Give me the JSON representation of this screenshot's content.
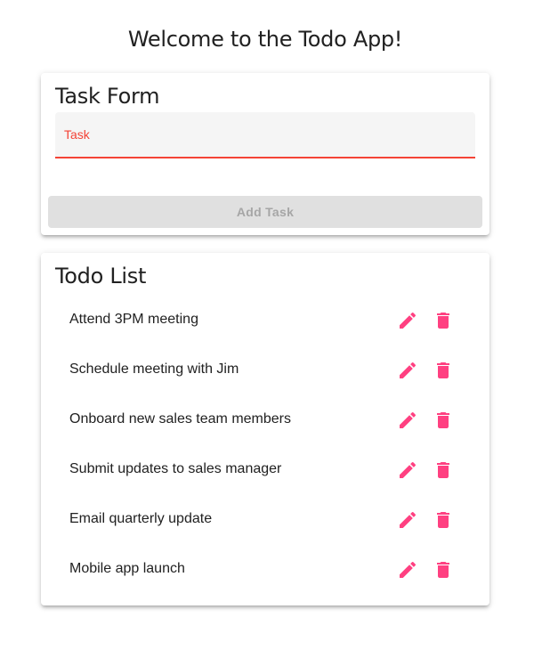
{
  "header": {
    "welcome": "Welcome to the Todo App!"
  },
  "task_form": {
    "title": "Task Form",
    "field_label": "Task",
    "field_value": "",
    "add_button_label": "Add Task"
  },
  "todo_list": {
    "title": "Todo List",
    "items": [
      {
        "text": "Attend 3PM meeting"
      },
      {
        "text": "Schedule meeting with Jim"
      },
      {
        "text": "Onboard new sales team members"
      },
      {
        "text": "Submit updates to sales manager"
      },
      {
        "text": "Email quarterly update"
      },
      {
        "text": "Mobile app launch"
      }
    ],
    "item_icons": [
      "pencil-icon",
      "trash-icon"
    ]
  },
  "colors": {
    "accent": "#f44336",
    "icon": "#ff4081",
    "disabled_bg": "#e0e0e0",
    "disabled_text": "#a6a6a6",
    "field_bg": "#f5f5f5"
  }
}
